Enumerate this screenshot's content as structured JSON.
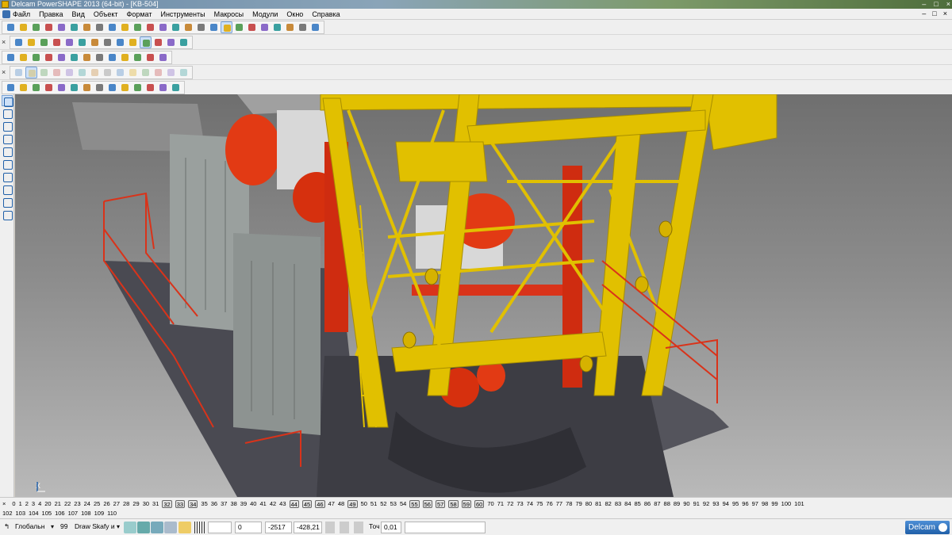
{
  "window": {
    "title": "Delcam PowerSHAPE 2013 (64-bit) - [KB-504]",
    "controls": [
      "–",
      "□",
      "×"
    ]
  },
  "menubar": {
    "items": [
      "Файл",
      "Правка",
      "Вид",
      "Объект",
      "Формат",
      "Инструменты",
      "Макросы",
      "Модули",
      "Окно",
      "Справка"
    ],
    "mdi_controls": [
      "–",
      "□",
      "×"
    ]
  },
  "toolbars": {
    "close_glyph": "×",
    "row1_icons": [
      "wizard-icon",
      "open-icon",
      "new-icon",
      "save-icon",
      "save-as-icon",
      "print-icon",
      "cut-icon",
      "copy-icon",
      "paste-icon",
      "delete-icon",
      "select-icon",
      "undo-icon",
      "redo-icon",
      "line-icon",
      "wireframe-icon",
      "shade-icon",
      "snap-icon",
      "select-arrow-icon",
      "circle-icon",
      "arc-icon",
      "spline-icon",
      "surface-icon",
      "solid-icon",
      "measure-icon",
      "magic-icon"
    ],
    "row2_icons": [
      "view-top-icon",
      "view-front-icon",
      "view-side-icon",
      "view-iso-icon",
      "view-rotate-icon",
      "zoom-icon",
      "zoom-in-icon",
      "zoom-out-icon",
      "zoom-all-icon",
      "zoom-box-icon",
      "shade-mode-icon",
      "shade-sel-icon",
      "light-icon",
      "layer-icon"
    ],
    "row3_icons": [
      "model-icon",
      "tree-icon",
      "doc-icon",
      "cube-icon",
      "sphere-icon",
      "ball-icon",
      "play-icon",
      "arrow-icon",
      "box-icon",
      "assembly-icon",
      "info-icon",
      "table-icon",
      "component-icon"
    ],
    "row4_icons": [
      "solid-extrude-icon",
      "solid-revolve-icon",
      "solid-fillet-icon",
      "solid-chamfer-icon",
      "solid-shell-icon",
      "solid-cut-icon",
      "solid-boolean-icon",
      "solid-split-icon",
      "solid-hole-icon",
      "solid-boss-icon",
      "solid-draft-icon",
      "solid-mirror-icon",
      "solid-pattern-icon",
      "solid-offset-icon"
    ],
    "row5_icons": [
      "part-icon",
      "part-copy-icon",
      "transform-icon",
      "move-icon",
      "rotate-icon",
      "scale-icon",
      "mirror-icon",
      "group-icon",
      "ungroup-icon",
      "hide-icon",
      "show-icon",
      "align-icon",
      "measure2-icon",
      "blend-icon"
    ],
    "left_icons": [
      "pointer-icon",
      "select-filter-icon",
      "line-tool-icon",
      "polyline-tool-icon",
      "rectangle-tool-icon",
      "polygon-tool-icon",
      "surface-tool-icon",
      "solid-tool-icon",
      "curve-tool-icon",
      "dimension-tool-icon"
    ]
  },
  "viewport": {
    "axis_label": "X",
    "colors": {
      "crane_yellow": "#e1c000",
      "machinery_red": "#e23a14",
      "cabinet_gray": "#9aa09e",
      "platform_dark": "#4a4a52",
      "railing_red": "#d9331a"
    }
  },
  "levels": {
    "close_glyph": "×",
    "row1": [
      {
        "n": "0",
        "on": false
      },
      {
        "n": "1",
        "on": false
      },
      {
        "n": "2",
        "on": false
      },
      {
        "n": "3",
        "on": false
      },
      {
        "n": "4",
        "on": false
      },
      {
        "n": "20",
        "on": false
      },
      {
        "n": "21",
        "on": false
      },
      {
        "n": "22",
        "on": false
      },
      {
        "n": "23",
        "on": false
      },
      {
        "n": "24",
        "on": false
      },
      {
        "n": "25",
        "on": false
      },
      {
        "n": "26",
        "on": false
      },
      {
        "n": "27",
        "on": false
      },
      {
        "n": "28",
        "on": false
      },
      {
        "n": "29",
        "on": false
      },
      {
        "n": "30",
        "on": false
      },
      {
        "n": "31",
        "on": false
      },
      {
        "n": "32",
        "on": true
      },
      {
        "n": "33",
        "on": true
      },
      {
        "n": "34",
        "on": true
      },
      {
        "n": "35",
        "on": false
      },
      {
        "n": "36",
        "on": false
      },
      {
        "n": "37",
        "on": false
      },
      {
        "n": "38",
        "on": false
      },
      {
        "n": "39",
        "on": false
      },
      {
        "n": "40",
        "on": false
      },
      {
        "n": "41",
        "on": false
      },
      {
        "n": "42",
        "on": false
      },
      {
        "n": "43",
        "on": false
      },
      {
        "n": "44",
        "on": true
      },
      {
        "n": "45",
        "on": true
      },
      {
        "n": "46",
        "on": true
      },
      {
        "n": "47",
        "on": false
      },
      {
        "n": "48",
        "on": false
      },
      {
        "n": "49",
        "on": true
      },
      {
        "n": "50",
        "on": false
      },
      {
        "n": "51",
        "on": false
      },
      {
        "n": "52",
        "on": false
      },
      {
        "n": "53",
        "on": false
      },
      {
        "n": "54",
        "on": false
      },
      {
        "n": "55",
        "on": true
      },
      {
        "n": "56",
        "on": true
      },
      {
        "n": "57",
        "on": true
      },
      {
        "n": "58",
        "on": true
      },
      {
        "n": "59",
        "on": true
      },
      {
        "n": "60",
        "on": true
      },
      {
        "n": "70",
        "on": false
      },
      {
        "n": "71",
        "on": false
      },
      {
        "n": "72",
        "on": false
      },
      {
        "n": "73",
        "on": false
      },
      {
        "n": "74",
        "on": false
      },
      {
        "n": "75",
        "on": false
      },
      {
        "n": "76",
        "on": false
      },
      {
        "n": "77",
        "on": false
      },
      {
        "n": "78",
        "on": false
      },
      {
        "n": "79",
        "on": false
      },
      {
        "n": "80",
        "on": false
      },
      {
        "n": "81",
        "on": false
      },
      {
        "n": "82",
        "on": false
      },
      {
        "n": "83",
        "on": false
      },
      {
        "n": "84",
        "on": false
      },
      {
        "n": "85",
        "on": false
      },
      {
        "n": "86",
        "on": false
      },
      {
        "n": "87",
        "on": false
      },
      {
        "n": "88",
        "on": false
      },
      {
        "n": "89",
        "on": false
      },
      {
        "n": "90",
        "on": false
      },
      {
        "n": "91",
        "on": false
      },
      {
        "n": "92",
        "on": false
      },
      {
        "n": "93",
        "on": false
      },
      {
        "n": "94",
        "on": false
      },
      {
        "n": "95",
        "on": false
      },
      {
        "n": "96",
        "on": false
      },
      {
        "n": "97",
        "on": false
      },
      {
        "n": "98",
        "on": false
      },
      {
        "n": "99",
        "on": false
      },
      {
        "n": "100",
        "on": false
      },
      {
        "n": "101",
        "on": false
      }
    ],
    "row2": [
      "102",
      "103",
      "104",
      "105",
      "106",
      "107",
      "108",
      "109",
      "110"
    ]
  },
  "statusbar": {
    "workplane": "Глобальн",
    "level_number": "99",
    "level_name": "Draw Skafy и",
    "coord_x": "0",
    "coord_y": "-2517",
    "coord_z": "-428,21",
    "tolerance_label": "Точ",
    "tolerance_value": "0,01",
    "brand": "Delcam"
  }
}
